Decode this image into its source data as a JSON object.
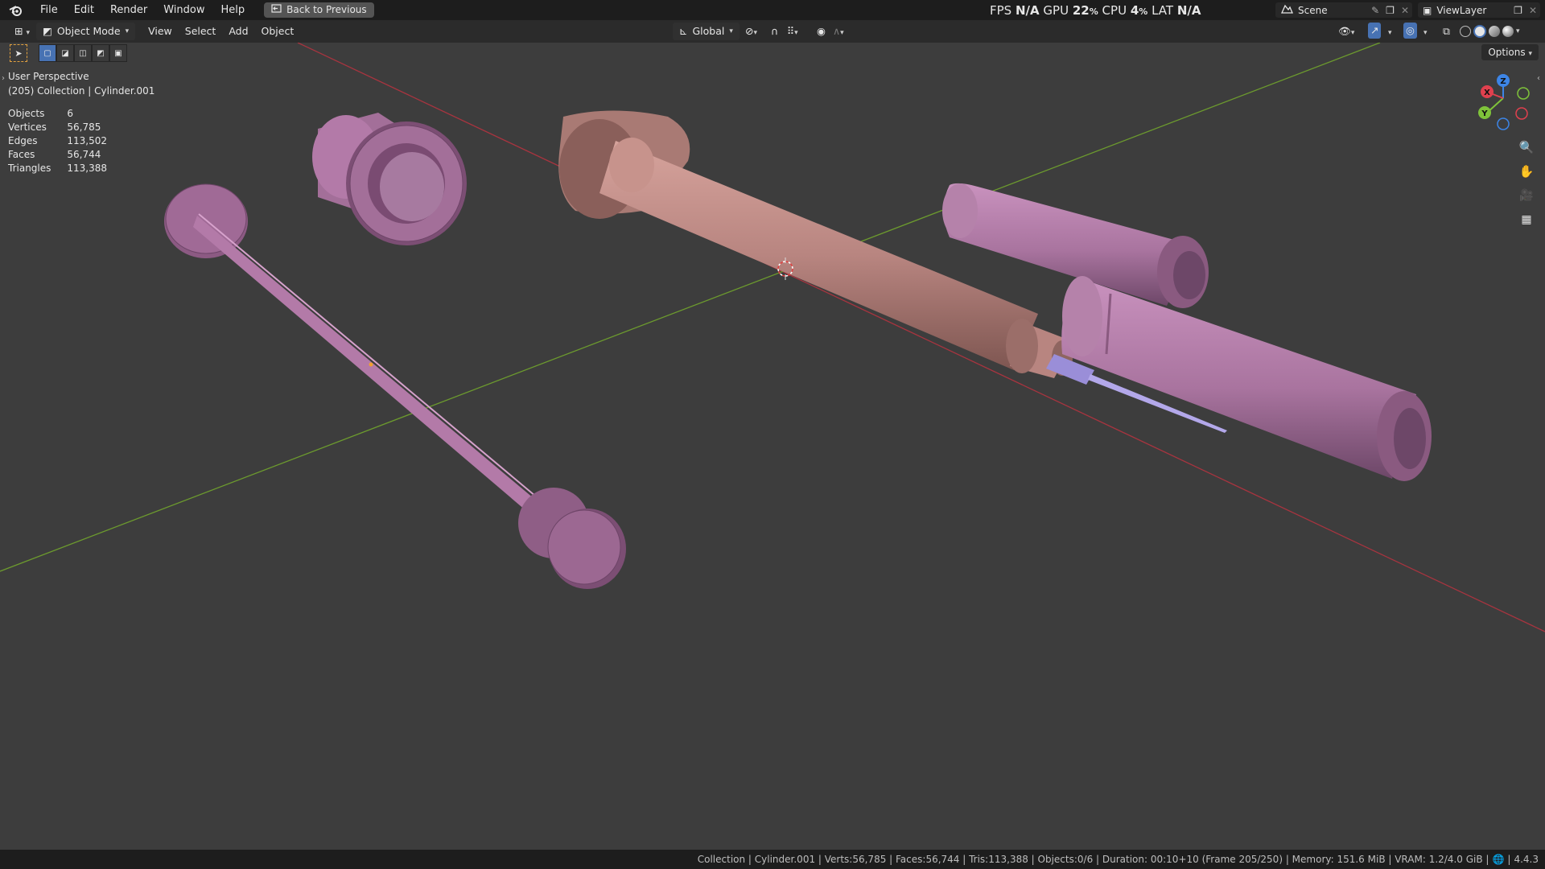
{
  "topbar": {
    "menus": [
      "File",
      "Edit",
      "Render",
      "Window",
      "Help"
    ],
    "back_label": "Back to Previous",
    "scene_name": "Scene",
    "viewlayer_name": "ViewLayer"
  },
  "hud": {
    "fps_label": "FPS",
    "fps_value": "N/A",
    "gpu_label": "GPU",
    "gpu_value": "22",
    "cpu_label": "CPU",
    "cpu_value": "4",
    "percent": "%",
    "lat_label": "LAT",
    "lat_value": "N/A"
  },
  "viewport_header": {
    "mode": "Object Mode",
    "menus": [
      "View",
      "Select",
      "Add",
      "Object"
    ],
    "orientation": "Global",
    "options_label": "Options"
  },
  "overlay": {
    "perspective": "User Perspective",
    "collection_line": "(205) Collection | Cylinder.001",
    "stats": [
      {
        "label": "Objects",
        "value": "6"
      },
      {
        "label": "Vertices",
        "value": "56,785"
      },
      {
        "label": "Edges",
        "value": "113,502"
      },
      {
        "label": "Faces",
        "value": "56,744"
      },
      {
        "label": "Triangles",
        "value": "113,388"
      }
    ]
  },
  "gizmo": {
    "x_label": "X",
    "y_label": "Y",
    "z_label": "Z",
    "colors": {
      "x": "#e0404e",
      "y": "#7fc33a",
      "z": "#3d85e6"
    }
  },
  "statusbar": {
    "text": "Collection | Cylinder.001 | Verts:56,785 | Faces:56,744 | Tris:113,388 | Objects:0/6 | Duration: 00:10+10 (Frame 205/250) | Memory: 151.6 MiB | VRAM: 1.2/4.0 GiB |",
    "version": "4.4.3"
  },
  "colors": {
    "viewport_bg": "#3d3d3d",
    "x_axis_line": "#a8343f",
    "y_axis_line": "#6c9a2e",
    "plunger": "#b37aa8",
    "barrel": "#b88580",
    "cap": "#a9749f",
    "needle": "#9a8ed8"
  }
}
